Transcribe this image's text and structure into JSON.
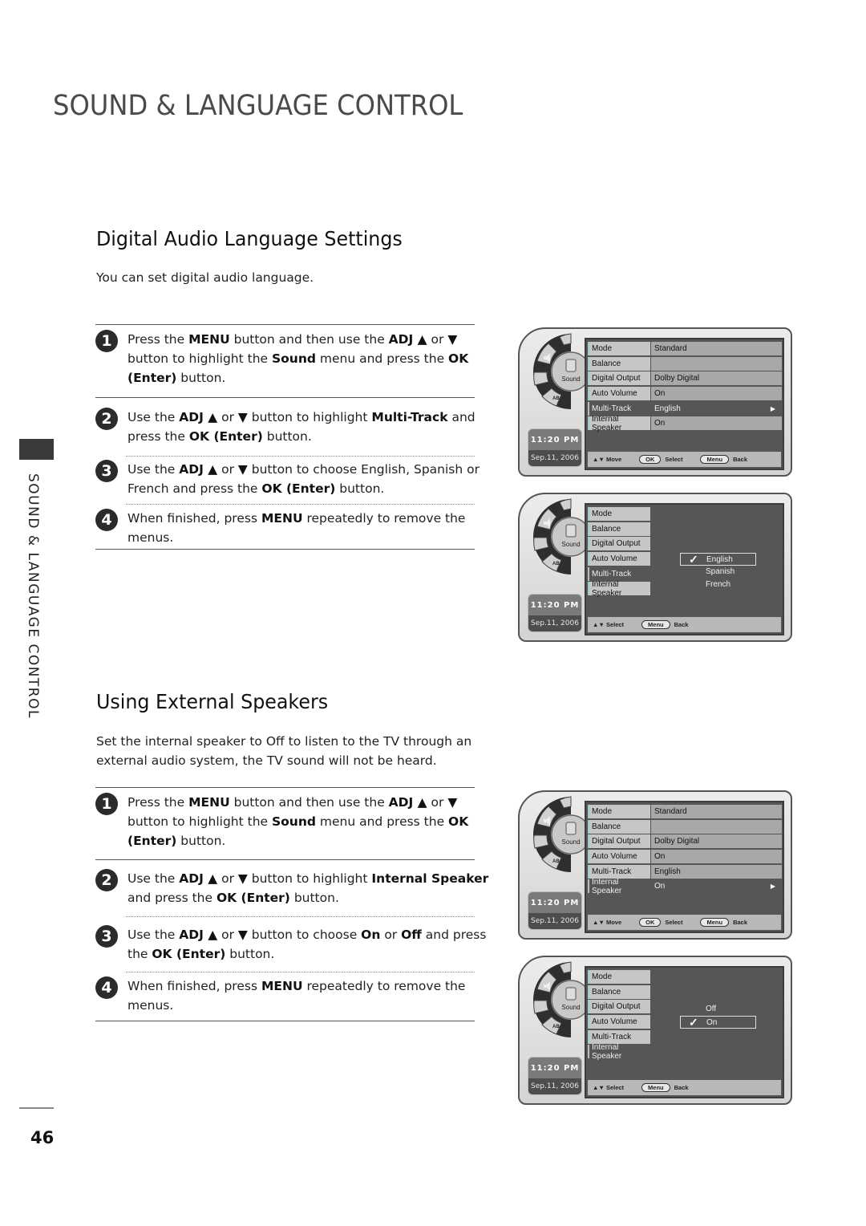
{
  "page": {
    "title": "SOUND & LANGUAGE CONTROL",
    "side_tab": "SOUND & LANGUAGE CONTROL",
    "page_number": "46"
  },
  "sections": [
    {
      "title": "Digital Audio Language Settings",
      "intro": "You can set digital audio language.",
      "steps": [
        {
          "num": "1",
          "parts": [
            {
              "t": "Press the "
            },
            {
              "b": "MENU"
            },
            {
              "t": " button and then use the "
            },
            {
              "b": "ADJ ▲"
            },
            {
              "t": " or "
            },
            {
              "b": "▼"
            },
            {
              "t": " button to highlight the "
            },
            {
              "b": "Sound"
            },
            {
              "t": " menu and press the "
            },
            {
              "b": "OK (Enter)"
            },
            {
              "t": " button."
            }
          ]
        },
        {
          "num": "2",
          "parts": [
            {
              "t": "Use the "
            },
            {
              "b": "ADJ ▲"
            },
            {
              "t": " or "
            },
            {
              "b": "▼"
            },
            {
              "t": " button to highlight "
            },
            {
              "b": "Multi-Track"
            },
            {
              "t": " and press the "
            },
            {
              "b": "OK (Enter)"
            },
            {
              "t": " button."
            }
          ]
        },
        {
          "num": "3",
          "parts": [
            {
              "t": "Use the "
            },
            {
              "b": "ADJ ▲"
            },
            {
              "t": " or "
            },
            {
              "b": "▼"
            },
            {
              "t": " button to choose English, Spanish or French and press the "
            },
            {
              "b": "OK (Enter)"
            },
            {
              "t": " button."
            }
          ]
        },
        {
          "num": "4",
          "parts": [
            {
              "t": "When finished, press "
            },
            {
              "b": "MENU"
            },
            {
              "t": " repeatedly to remove the menus."
            }
          ]
        }
      ]
    },
    {
      "title": "Using External Speakers",
      "intro": "Set the internal speaker to Off to listen to the TV through an external audio system, the TV sound will not be heard.",
      "steps": [
        {
          "num": "1",
          "parts": [
            {
              "t": "Press the "
            },
            {
              "b": "MENU"
            },
            {
              "t": " button and then use the "
            },
            {
              "b": "ADJ ▲"
            },
            {
              "t": " or "
            },
            {
              "b": "▼"
            },
            {
              "t": " button to highlight the "
            },
            {
              "b": "Sound"
            },
            {
              "t": " menu and press the "
            },
            {
              "b": "OK (Enter)"
            },
            {
              "t": " button."
            }
          ]
        },
        {
          "num": "2",
          "parts": [
            {
              "t": "Use the "
            },
            {
              "b": "ADJ ▲"
            },
            {
              "t": " or "
            },
            {
              "b": "▼"
            },
            {
              "t": " button to highlight "
            },
            {
              "b": "Internal Speaker"
            },
            {
              "t": " and press the "
            },
            {
              "b": "OK (Enter)"
            },
            {
              "t": " button."
            }
          ]
        },
        {
          "num": "3",
          "parts": [
            {
              "t": "Use the "
            },
            {
              "b": "ADJ ▲"
            },
            {
              "t": " or "
            },
            {
              "b": "▼"
            },
            {
              "t": " button to choose "
            },
            {
              "b": "On"
            },
            {
              "t": " or "
            },
            {
              "b": "Off"
            },
            {
              "t": " and press the "
            },
            {
              "b": "OK (Enter)"
            },
            {
              "t": " button."
            }
          ]
        },
        {
          "num": "4",
          "parts": [
            {
              "t": "When finished, press "
            },
            {
              "b": "MENU"
            },
            {
              "t": " repeatedly to remove the menus."
            }
          ]
        }
      ]
    }
  ],
  "osd": {
    "wheel_label": "Sound",
    "wheel_icons": [
      "picture-icon",
      "sound-icon",
      "antenna-icon",
      "caption-icon",
      "ab-icon"
    ],
    "ab_label": "AB",
    "time": "11:20 PM",
    "date": "Sep.11, 2006",
    "colors": {
      "screen": "#565656",
      "label": "#c6c6c6",
      "value": "#a8a8a8",
      "bar": "#b8b8b8",
      "frame": "#d8d8d8"
    },
    "panels": [
      {
        "type": "list",
        "rows": [
          {
            "label": "Mode",
            "value": "Standard"
          },
          {
            "label": "Balance",
            "value": ""
          },
          {
            "label": "Digital Output",
            "value": "Dolby Digital"
          },
          {
            "label": "Auto Volume",
            "value": "On"
          },
          {
            "label": "Multi-Track",
            "value": "English",
            "selected": true
          },
          {
            "label": "Internal Speaker",
            "value": "On"
          }
        ],
        "bar": {
          "nav": "Move",
          "ok": "OK",
          "ok_action": "Select",
          "menu": "Menu",
          "menu_action": "Back"
        }
      },
      {
        "type": "popup",
        "rows": [
          "Mode",
          "Balance",
          "Digital Output",
          "Auto Volume",
          "Multi-Track",
          "Internal Speaker"
        ],
        "selected_row": "Multi-Track",
        "options": [
          "English",
          "Spanish",
          "French"
        ],
        "checked": "English",
        "bar": {
          "nav": "Select",
          "menu": "Menu",
          "menu_action": "Back"
        }
      },
      {
        "type": "list",
        "rows": [
          {
            "label": "Mode",
            "value": "Standard"
          },
          {
            "label": "Balance",
            "value": ""
          },
          {
            "label": "Digital Output",
            "value": "Dolby Digital"
          },
          {
            "label": "Auto Volume",
            "value": "On"
          },
          {
            "label": "Multi-Track",
            "value": "English"
          },
          {
            "label": "Internal Speaker",
            "value": "On",
            "selected": true
          }
        ],
        "bar": {
          "nav": "Move",
          "ok": "OK",
          "ok_action": "Select",
          "menu": "Menu",
          "menu_action": "Back"
        }
      },
      {
        "type": "popup",
        "rows": [
          "Mode",
          "Balance",
          "Digital Output",
          "Auto Volume",
          "Multi-Track",
          "Internal Speaker"
        ],
        "selected_row": "Internal Speaker",
        "options": [
          "Off",
          "On"
        ],
        "checked": "On",
        "bar": {
          "nav": "Select",
          "menu": "Menu",
          "menu_action": "Back"
        }
      }
    ]
  }
}
